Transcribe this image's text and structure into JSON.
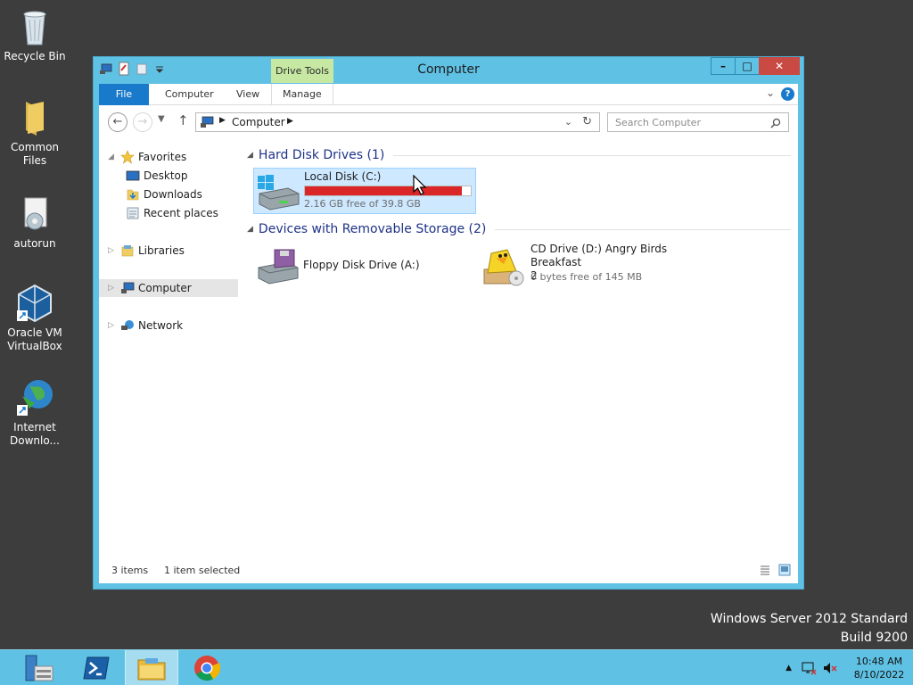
{
  "desktop": {
    "icons": [
      {
        "label": "Recycle Bin"
      },
      {
        "label": "Common Files"
      },
      {
        "label": "autorun"
      },
      {
        "label": "Oracle VM VirtualBox"
      },
      {
        "label": "Internet Downlo..."
      }
    ]
  },
  "window": {
    "title": "Computer",
    "contextual_tab": "Drive Tools",
    "ribbon_tabs": [
      "File",
      "Computer",
      "View",
      "Manage"
    ],
    "minimize": "–",
    "maximize": "□",
    "close": "✕",
    "help": "?"
  },
  "address": {
    "crumb": "Computer",
    "search_placeholder": "Search Computer"
  },
  "sidebar": {
    "favorites": "Favorites",
    "desktop": "Desktop",
    "downloads": "Downloads",
    "recent": "Recent places",
    "libraries": "Libraries",
    "computer": "Computer",
    "network": "Network"
  },
  "groups": {
    "hdd": "Hard Disk Drives (1)",
    "removable": "Devices with Removable Storage (2)"
  },
  "drives": {
    "c": {
      "name": "Local Disk (C:)",
      "free": "2.16 GB free of 39.8 GB",
      "used_fraction": 0.946
    },
    "a": {
      "name": "Floppy Disk Drive (A:)"
    },
    "d": {
      "name_line1": "CD Drive (D:) Angry Birds Breakfast",
      "name_line2": "2",
      "free": "0 bytes free of 145 MB"
    }
  },
  "status": {
    "items": "3 items",
    "selected": "1 item selected"
  },
  "watermark": {
    "line1": "Windows Server 2012 Standard",
    "line2": "Build 9200"
  },
  "clock": {
    "time": "10:48 AM",
    "date": "8/10/2022"
  }
}
